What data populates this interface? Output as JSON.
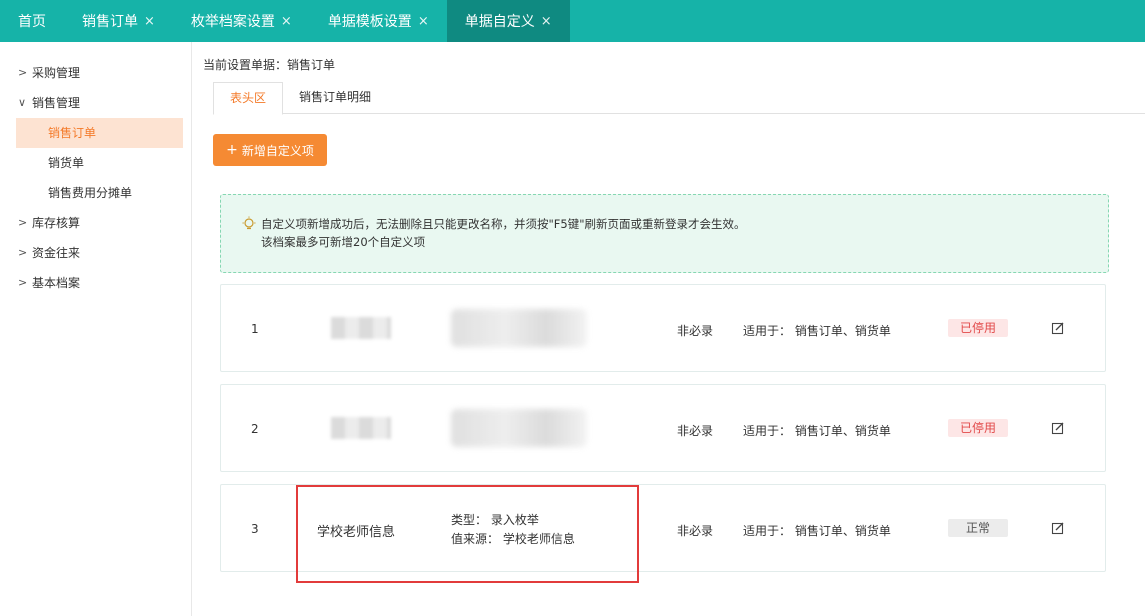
{
  "tabs": [
    {
      "label": "首页",
      "closable": false
    },
    {
      "label": "销售订单",
      "closable": true
    },
    {
      "label": "枚举档案设置",
      "closable": true
    },
    {
      "label": "单据模板设置",
      "closable": true
    },
    {
      "label": "单据自定义",
      "closable": true,
      "active": true
    }
  ],
  "close_glyph": "×",
  "sidebar": {
    "groups": [
      {
        "label": "采购管理",
        "expanded": false
      },
      {
        "label": "销售管理",
        "expanded": true,
        "children": [
          "销售订单",
          "销货单",
          "销售费用分摊单"
        ]
      },
      {
        "label": "库存核算",
        "expanded": false
      },
      {
        "label": "资金往来",
        "expanded": false
      },
      {
        "label": "基本档案",
        "expanded": false
      }
    ]
  },
  "main": {
    "breadcrumb": "当前设置单据：销售订单",
    "subtabs": [
      "表头区",
      "销售订单明细"
    ],
    "add_button": "新增自定义项",
    "tip_lines": [
      "自定义项新增成功后，无法删除且只能更改名称，并须按\"F5键\"刷新页面或重新登录才会生效。",
      "该档案最多可新增20个自定义项"
    ],
    "rows": [
      {
        "index": "1",
        "required": "非必录",
        "applies": "适用于：  销售订单、销货单",
        "status": "已停用"
      },
      {
        "index": "2",
        "required": "非必录",
        "applies": "适用于：  销售订单、销货单",
        "status": "已停用"
      },
      {
        "index": "3",
        "name": "学校老师信息",
        "type": "类型：  录入枚举",
        "source": "值来源：  学校老师信息",
        "required": "非必录",
        "applies": "适用于：  销售订单、销货单",
        "status": "正常"
      }
    ]
  },
  "colors": {
    "brand": "#16b3a8",
    "brand_dark": "#0f8a81",
    "accent": "#f58a33",
    "stop": "#e24a4a",
    "highlight": "#e23b3b"
  },
  "icons": {
    "bulb": "bulb-icon",
    "edit": "edit-icon",
    "caret_right": "chevron-right-icon",
    "caret_down": "chevron-down-icon"
  }
}
